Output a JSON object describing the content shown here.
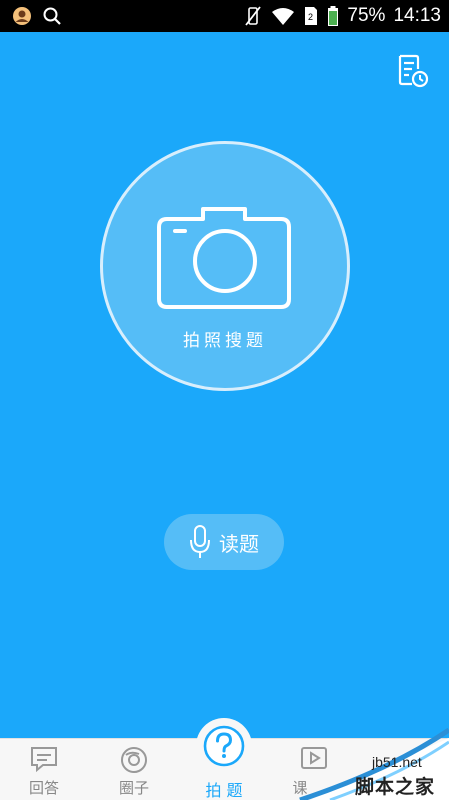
{
  "status_bar": {
    "battery": "75%",
    "time": "14:13"
  },
  "main": {
    "camera_button_label": "拍照搜题",
    "read_button_label": "读题",
    "accent_color": "#1ba8fa"
  },
  "tab_bar": {
    "tabs": [
      {
        "label": "回答",
        "icon": "chat-icon"
      },
      {
        "label": "圈子",
        "icon": "circle-icon"
      },
      {
        "label": "拍 题",
        "icon": "question-icon"
      },
      {
        "label": "课",
        "icon": "play-icon"
      }
    ]
  },
  "watermark": {
    "line1": "jb51.net",
    "line2": "脚本之家"
  }
}
